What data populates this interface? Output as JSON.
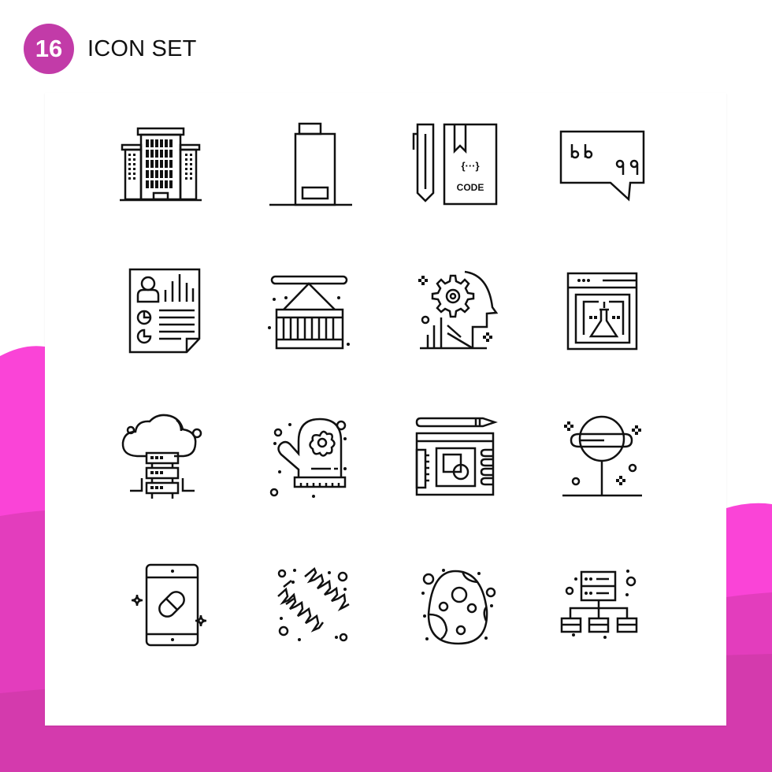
{
  "header": {
    "count": "16",
    "title": "ICON SET"
  },
  "colors": {
    "badge": "#c23ba8",
    "accent_bright": "#fa44d7",
    "accent_mid": "#e33dbd",
    "accent_dark": "#d43aad",
    "stroke": "#111111",
    "card": "#ffffff"
  },
  "icons": [
    {
      "name": "office-building",
      "row": 1,
      "col": 1
    },
    {
      "name": "low-battery",
      "row": 1,
      "col": 2
    },
    {
      "name": "code-book-and-pencil",
      "row": 1,
      "col": 3,
      "label": "CODE",
      "glyph": "{···}"
    },
    {
      "name": "quote-speech-bubble",
      "row": 1,
      "col": 4,
      "glyph": "b b q q"
    },
    {
      "name": "resume-report",
      "row": 2,
      "col": 1
    },
    {
      "name": "cargo-container",
      "row": 2,
      "col": 2
    },
    {
      "name": "mind-gear-head",
      "row": 2,
      "col": 3
    },
    {
      "name": "web-lab-flask",
      "row": 2,
      "col": 4
    },
    {
      "name": "cloud-server",
      "row": 3,
      "col": 1
    },
    {
      "name": "oven-mitt",
      "row": 3,
      "col": 2
    },
    {
      "name": "design-tablet-pencil",
      "row": 3,
      "col": 3
    },
    {
      "name": "lollipop",
      "row": 3,
      "col": 4
    },
    {
      "name": "mobile-pill",
      "row": 4,
      "col": 1
    },
    {
      "name": "dna-helix",
      "row": 4,
      "col": 2
    },
    {
      "name": "easter-egg",
      "row": 4,
      "col": 3
    },
    {
      "name": "server-network",
      "row": 4,
      "col": 4
    }
  ]
}
